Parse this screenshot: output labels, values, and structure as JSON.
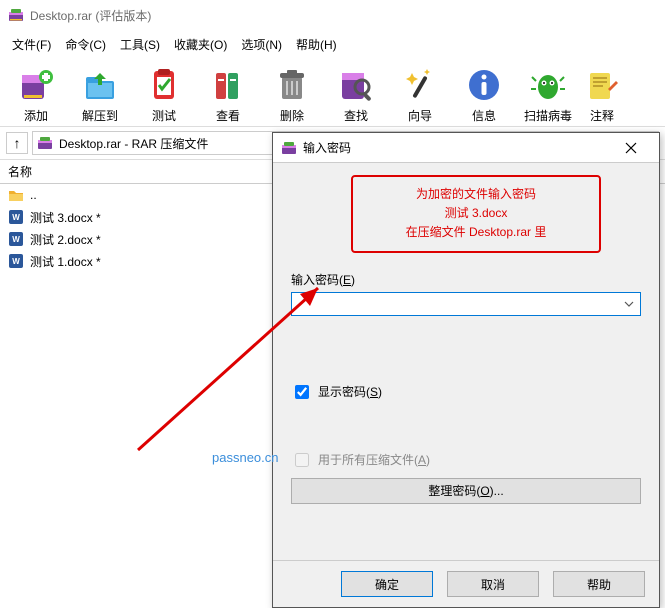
{
  "window": {
    "title": "Desktop.rar (评估版本)"
  },
  "menu": {
    "file": "文件(F)",
    "cmd": "命令(C)",
    "tools": "工具(S)",
    "fav": "收藏夹(O)",
    "options": "选项(N)",
    "help": "帮助(H)"
  },
  "toolbar": {
    "add": "添加",
    "extract": "解压到",
    "test": "测试",
    "view": "查看",
    "delete": "删除",
    "find": "查找",
    "wizard": "向导",
    "info": "信息",
    "scan": "扫描病毒",
    "comment": "注释"
  },
  "nav": {
    "up": "↑",
    "address": "Desktop.rar - RAR 压缩文件"
  },
  "list": {
    "header_name": "名称",
    "parent": "..",
    "files": [
      {
        "name": "测试 3.docx *"
      },
      {
        "name": "测试 2.docx *"
      },
      {
        "name": "测试 1.docx *"
      }
    ]
  },
  "dialog": {
    "title": "输入密码",
    "msg_line1": "为加密的文件输入密码",
    "msg_line2": "测试 3.docx",
    "msg_line3": "在压缩文件 Desktop.rar 里",
    "input_label_pre": "输入密码(",
    "input_label_u": "E",
    "input_label_post": ")",
    "input_value": "",
    "show_pw_pre": "显示密码(",
    "show_pw_u": "S",
    "show_pw_post": ")",
    "all_archives_pre": "用于所有压缩文件(",
    "all_archives_u": "A",
    "all_archives_post": ")",
    "manage_pre": "整理密码(",
    "manage_u": "O",
    "manage_post": ")...",
    "ok": "确定",
    "cancel": "取消",
    "help": "帮助"
  },
  "watermark": "passneo.cn"
}
